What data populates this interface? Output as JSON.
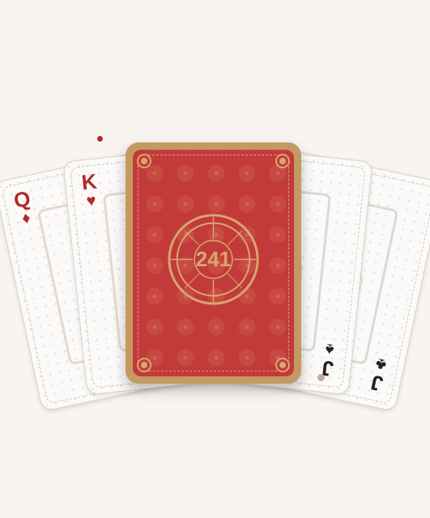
{
  "cards": [
    {
      "rank": "Q",
      "suit": "♦",
      "color": "red"
    },
    {
      "rank": "K",
      "suit": "♥",
      "color": "red"
    },
    {
      "rank": "J",
      "suit": "♠",
      "color": "black"
    },
    {
      "rank": "J",
      "suit": "♣",
      "color": "black"
    }
  ],
  "back": {
    "number": "241"
  },
  "colors": {
    "background": "#f8f4ef",
    "card_back_red": "#c23b3a",
    "card_back_gold": "#d8a76e",
    "red_suit": "#b3292c",
    "black_suit": "#222222"
  }
}
